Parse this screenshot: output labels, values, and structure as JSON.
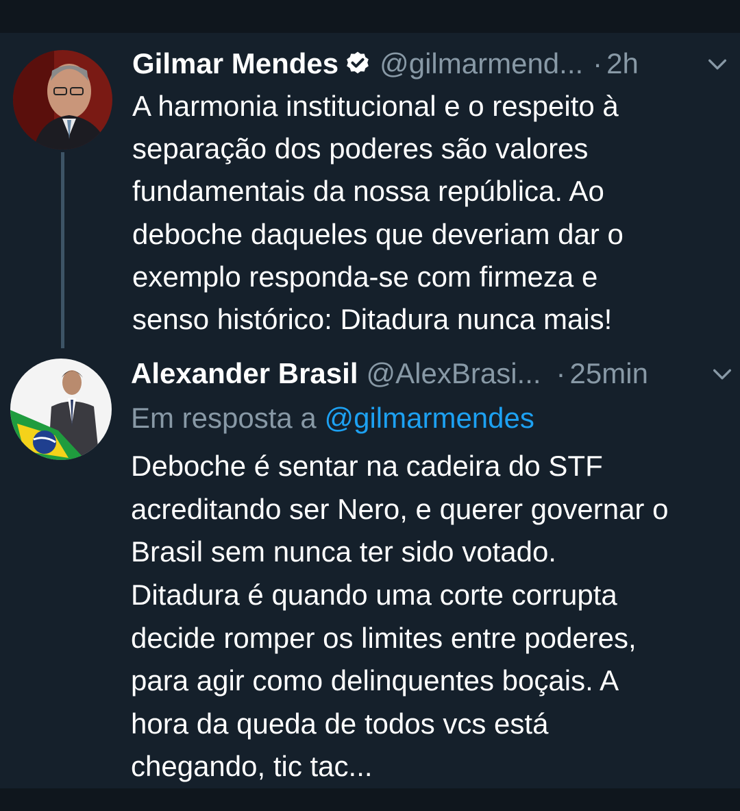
{
  "tweets": [
    {
      "name": "Gilmar Mendes",
      "handle": "@gilmarmend...",
      "separator": "·",
      "time": "2h",
      "verified": true,
      "body_lines": [
        "A harmonia institucional e o respeito à",
        "separação dos poderes são valores",
        "fundamentais da nossa república. Ao",
        "deboche daqueles que deveriam dar o",
        "exemplo responda-se com firmeza e",
        "senso histórico: Ditadura nunca mais!"
      ]
    },
    {
      "name": "Alexander Brasil",
      "handle": "@AlexBrasi...",
      "separator": "·",
      "time": "25min",
      "verified": false,
      "reply_prefix": "Em resposta a",
      "reply_mention": "@gilmarmendes",
      "body_lines": [
        "Deboche é sentar na cadeira do STF",
        "acreditando ser Nero, e querer governar o",
        "Brasil sem nunca ter sido votado.",
        "Ditadura é quando uma corte corrupta",
        "decide romper os limites entre poderes,",
        "para agir como delinquentes boçais. A",
        "hora da queda de todos vcs está",
        "chegando, tic tac..."
      ]
    }
  ],
  "colors": {
    "background": "#15202b",
    "secondary_text": "#8899a6",
    "link": "#1da1f2",
    "thread_line": "#3d5466"
  },
  "icons": [
    "verified-badge-icon",
    "chevron-down-icon"
  ]
}
